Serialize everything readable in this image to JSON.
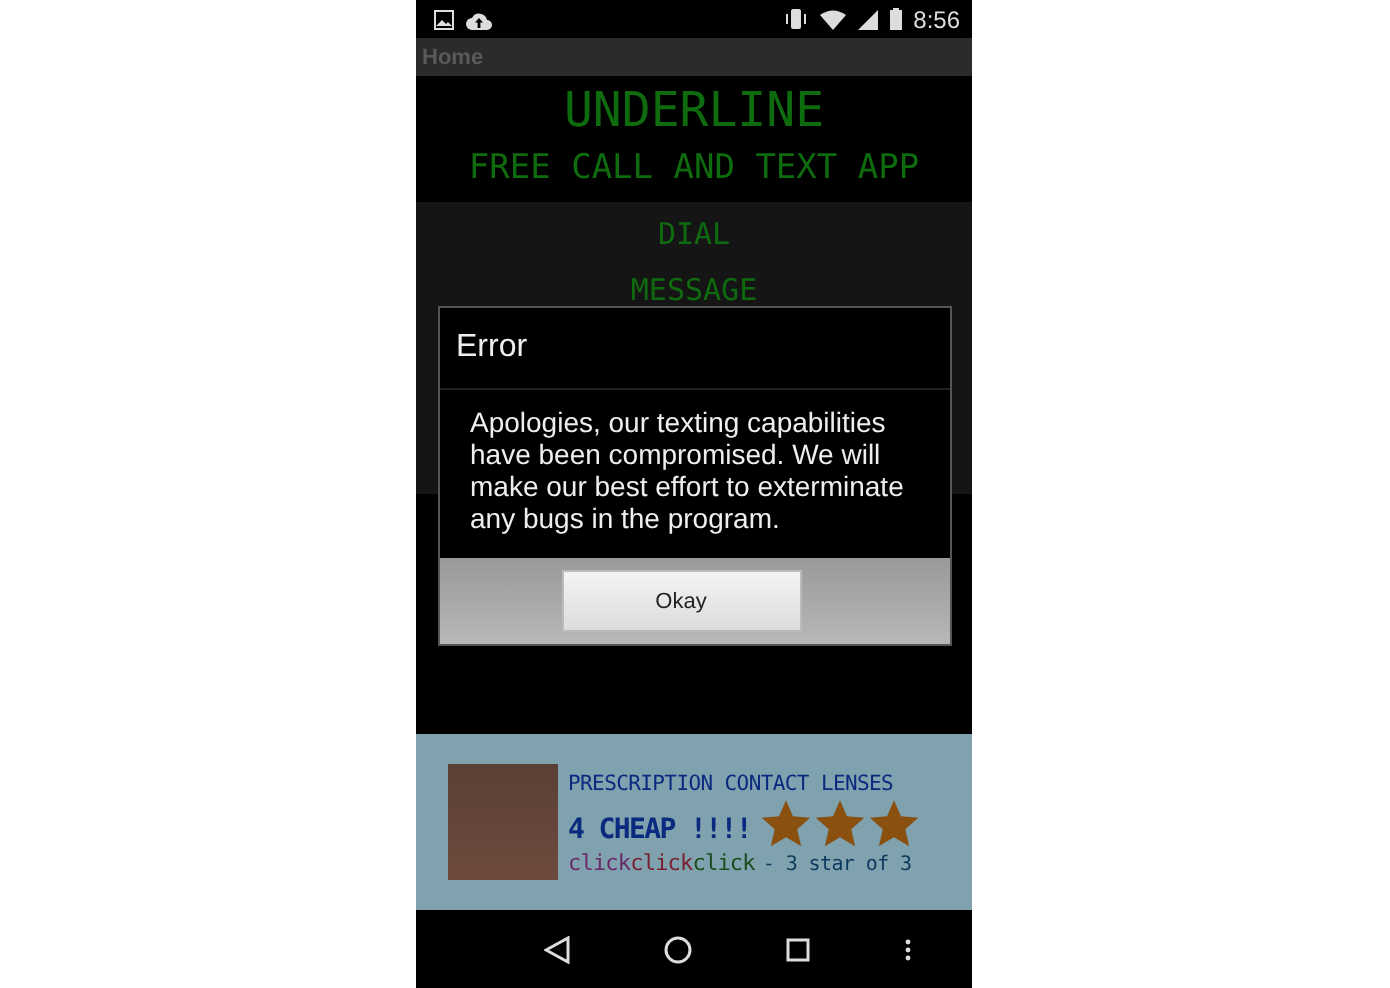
{
  "status_bar": {
    "time": "8:56"
  },
  "action_bar": {
    "title": "Home"
  },
  "app_title": "UNDERLINE",
  "app_subtitle": "FREE CALL AND TEXT APP",
  "menu": [
    "DIAL",
    "MESSAGE"
  ],
  "dialog": {
    "title": "Error",
    "message": "Apologies, our texting capabilities have been compromised. We will make our best effort to exterminate any bugs in the program.",
    "button": "Okay"
  },
  "ad": {
    "headline": "PRESCRIPTION CONTACT LENSES",
    "offer": "4 CHEAP !!!!",
    "stars": 3,
    "clicks": [
      {
        "text": "click",
        "color": "#6a2a6a"
      },
      {
        "text": "click",
        "color": "#7a2030"
      },
      {
        "text": "click",
        "color": "#1e4a1e"
      }
    ],
    "rating": "- 3 star of 3"
  }
}
